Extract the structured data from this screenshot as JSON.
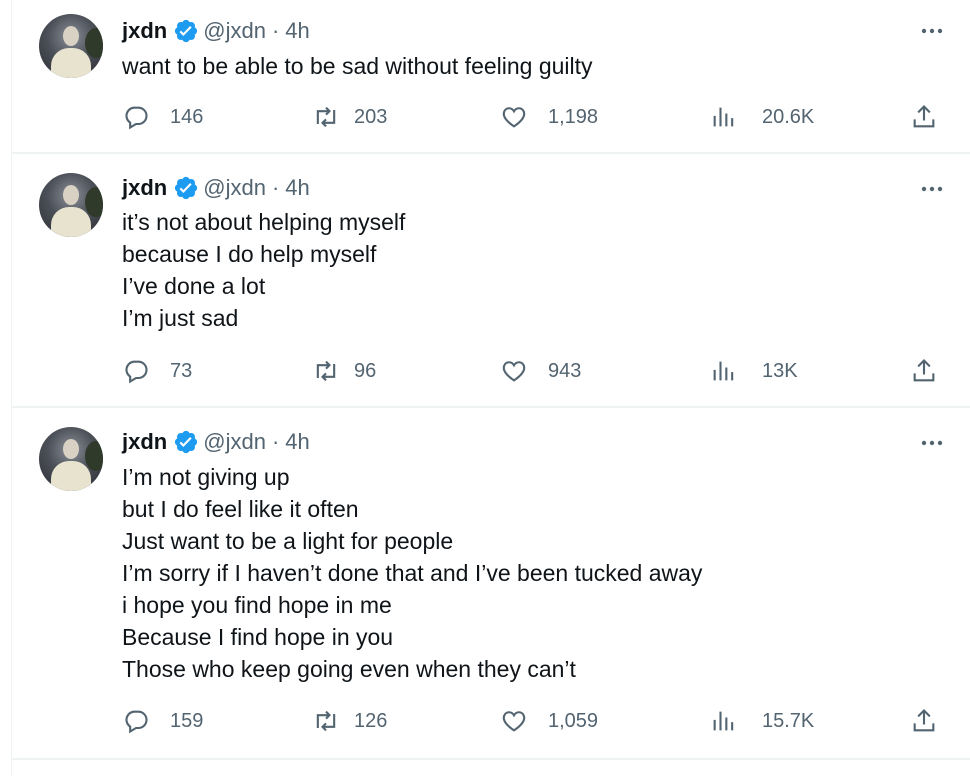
{
  "colors": {
    "verified": "#1d9bf0",
    "muted": "#536471",
    "text": "#0f1419"
  },
  "tweets": [
    {
      "name": "jxdn",
      "handle": "@jxdn",
      "separator": "·",
      "time": "4h",
      "lines": [
        "want to be able to be sad without feeling guilty"
      ],
      "stats": {
        "replies": "146",
        "reposts": "203",
        "likes": "1,198",
        "views": "20.6K"
      }
    },
    {
      "name": "jxdn",
      "handle": "@jxdn",
      "separator": "·",
      "time": "4h",
      "lines": [
        "it’s not about helping myself",
        "because I do help myself",
        "I’ve done a lot",
        "I’m just sad"
      ],
      "stats": {
        "replies": "73",
        "reposts": "96",
        "likes": "943",
        "views": "13K"
      }
    },
    {
      "name": "jxdn",
      "handle": "@jxdn",
      "separator": "·",
      "time": "4h",
      "lines": [
        "I’m not giving up",
        "but I do feel like it often",
        "Just want to be a light for people",
        "I’m sorry if I haven’t done that and I’ve been tucked away",
        "i hope you find hope in me",
        "Because I find hope in you",
        "Those who keep going even when they can’t"
      ],
      "stats": {
        "replies": "159",
        "reposts": "126",
        "likes": "1,059",
        "views": "15.7K"
      }
    }
  ],
  "icons": [
    "verified-icon",
    "more-icon",
    "reply-icon",
    "repost-icon",
    "like-icon",
    "views-icon",
    "share-icon"
  ]
}
